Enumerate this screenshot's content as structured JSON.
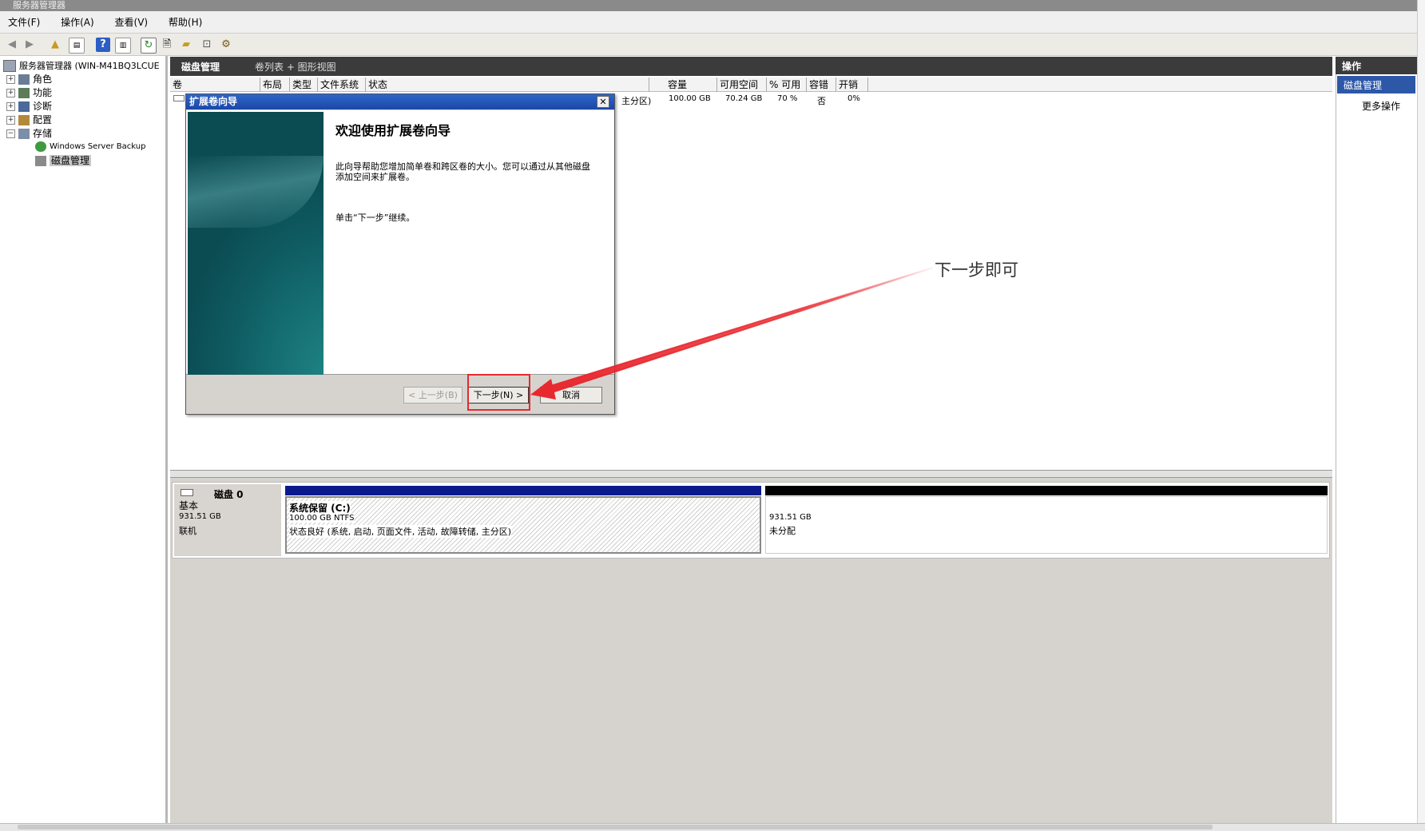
{
  "window": {
    "title": "服务器管理器"
  },
  "menu": [
    {
      "label": "文件(F)"
    },
    {
      "label": "操作(A)"
    },
    {
      "label": "查看(V)"
    },
    {
      "label": "帮助(H)"
    }
  ],
  "toolbar": {
    "icons": [
      "back-icon",
      "forward-icon",
      "up-folder-icon",
      "show-hide-console-tree-icon",
      "help-icon",
      "show-action-pane-icon",
      "refresh-icon",
      "properties-icon",
      "open-icon",
      "rescan-icon",
      "settings-icon"
    ]
  },
  "tree": {
    "root": "服务器管理器 (WIN-M41BQ3LCUE",
    "items": [
      {
        "label": "角色"
      },
      {
        "label": "功能"
      },
      {
        "label": "诊断"
      },
      {
        "label": "配置"
      },
      {
        "label": "存储"
      },
      {
        "label": "Windows Server Backup"
      },
      {
        "label": "磁盘管理"
      }
    ]
  },
  "center": {
    "title": "磁盘管理",
    "view": "卷列表 + 图形视图",
    "columns": [
      "卷",
      "布局",
      "类型",
      "文件系统",
      "状态",
      "容量",
      "可用空间",
      "% 可用",
      "容错",
      "开销"
    ],
    "rows": [
      {
        "status_tail": "主分区)",
        "capacity": "100.00 GB",
        "free": "70.24 GB",
        "pct": "70 %",
        "fault": "否",
        "overhead": "0%"
      }
    ]
  },
  "disk": {
    "name": "磁盘 0",
    "type": "基本",
    "size": "931.51 GB",
    "state": "联机",
    "partitions": [
      {
        "name": "系统保留  (C:)",
        "detail": "100.00 GB NTFS",
        "status": "状态良好 (系统, 启动, 页面文件, 活动, 故障转储, 主分区)"
      },
      {
        "size": "931.51 GB",
        "status": "未分配"
      }
    ]
  },
  "actions": {
    "header": "操作",
    "selected": "磁盘管理",
    "more": "更多操作"
  },
  "wizard": {
    "title": "扩展卷向导",
    "close": "✕",
    "heading": "欢迎使用扩展卷向导",
    "text1": "此向导帮助您增加简单卷和跨区卷的大小。您可以通过从其他磁盘添加空间来扩展卷。",
    "text2": "单击“下一步”继续。",
    "back_label": "< 上一步(B)",
    "next_label": "下一步(N) >",
    "cancel_label": "取消"
  },
  "annotation": {
    "text": "下一步即可",
    "color": "#e8282f"
  }
}
